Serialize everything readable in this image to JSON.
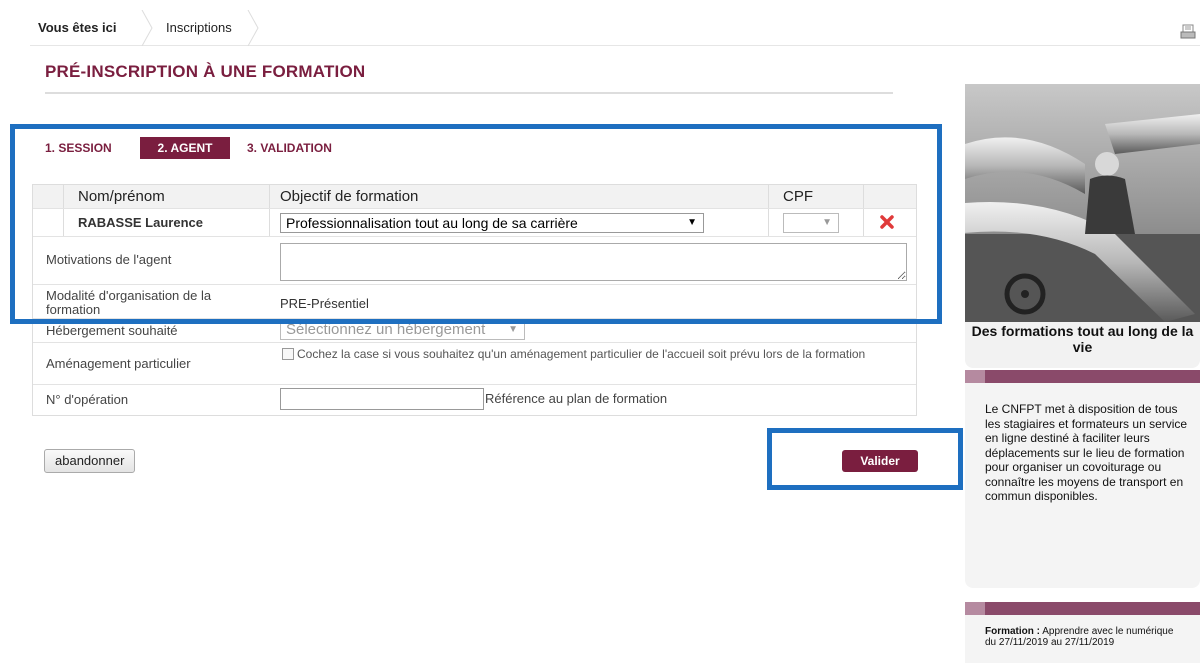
{
  "breadcrumb": {
    "here_label": "Vous êtes ici",
    "current": "Inscriptions"
  },
  "page_title": "PRÉ-INSCRIPTION À UNE FORMATION",
  "steps": {
    "step1": "1. SESSION",
    "step2": "2. AGENT",
    "step3": "3. VALIDATION"
  },
  "table": {
    "headers": {
      "name": "Nom/prénom",
      "objective": "Objectif de formation",
      "cpf": "CPF"
    },
    "agent": {
      "name": "RABASSE Laurence",
      "objective": "Professionnalisation tout au long de sa carrière",
      "cpf": ""
    }
  },
  "fields": {
    "motivations_label": "Motivations de l'agent",
    "motivations_value": "",
    "modalite_label": "Modalité d'organisation de la formation",
    "modalite_value": "PRE-Présentiel",
    "hebergement_label": "Hébergement souhaité",
    "hebergement_value": "Sélectionnez un hébergement",
    "amenagement_label": "Aménagement particulier",
    "amenagement_text": "Cochez la case si vous souhaitez qu'un aménagement particulier de l'accueil soit prévu lors de la formation",
    "operation_label": "N° d'opération",
    "operation_value": "",
    "operation_hint": "Référence au plan de formation"
  },
  "buttons": {
    "abandon": "abandonner",
    "valider": "Valider"
  },
  "sidebar": {
    "photo_caption": "Des formations tout au long de la vie",
    "panel1_text": "Le CNFPT met à disposition de tous les stagiaires et formateurs un service en ligne destiné à faciliter leurs déplacements sur le lieu de formation pour organiser un covoiturage ou connaître les moyens de transport en commun disponibles.",
    "panel2_label": "Formation :",
    "panel2_text": " Apprendre avec le numérique",
    "panel2_dates": "du 27/11/2019 au 27/11/2019"
  },
  "colors": {
    "brand": "#7a1e3f",
    "highlight": "#1e6fc0",
    "panel_bar": "#8a4a6a"
  },
  "icons": {
    "print": "print-icon",
    "remove": "close-icon",
    "dropdown": "chevron-down-icon"
  }
}
